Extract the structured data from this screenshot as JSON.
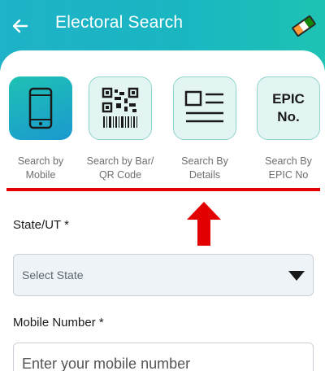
{
  "header": {
    "title": "Electoral Search",
    "back_icon": "arrow-left-icon",
    "logo_icon": "eci-logo-icon"
  },
  "tiles": [
    {
      "label": "Search by\nMobile",
      "icon": "mobile-phone-icon",
      "active": true
    },
    {
      "label": "Search by Bar/\nQR Code",
      "icon": "qr-code-icon",
      "active": false
    },
    {
      "label": "Search By\nDetails",
      "icon": "id-card-icon",
      "active": false
    },
    {
      "label": "Search By\nEPIC No",
      "icon_text": "EPIC\nNo.",
      "active": false
    }
  ],
  "form": {
    "state_label": "State/UT *",
    "state_placeholder": "Select State",
    "mobile_label": "Mobile Number *",
    "mobile_placeholder": "Enter your mobile number"
  },
  "colors": {
    "header_gradient_start": "#1fb2c8",
    "header_gradient_end": "#1ec3b3",
    "tile_bg": "#e3f5f2",
    "highlight": "#e30000"
  }
}
